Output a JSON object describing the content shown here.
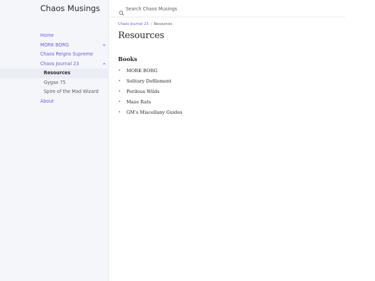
{
  "site": {
    "title": "Chaos Musings"
  },
  "search": {
    "placeholder": "Search Chaos Musings"
  },
  "nav": {
    "items": [
      {
        "label": "Home"
      },
      {
        "label": "MORK BORG"
      },
      {
        "label": "Chaos Reigns Supreme"
      },
      {
        "label": "Chaos Journal 23"
      },
      {
        "label": "About"
      }
    ],
    "sub_items": [
      {
        "label": "Resources"
      },
      {
        "label": "Gygax 75"
      },
      {
        "label": "Spire of the Mad Wizard"
      }
    ]
  },
  "breadcrumb": {
    "parent": "Chaos Journal 23",
    "separator": "/",
    "current": "Resources"
  },
  "page": {
    "title": "Resources",
    "section_heading": "Books",
    "bullet": "•",
    "books": [
      "MORK BORG",
      "Solitary Defilement",
      "Perilous Wilds",
      "Maze Rats",
      "GM's Miscellany Guides"
    ]
  },
  "colors": {
    "accent": "#7253ed",
    "sidebar_bg": "#f5f6fa",
    "active_bg": "#ebedf5",
    "text": "#27262b",
    "muted": "#5c5962"
  },
  "icons": {
    "search": "search-icon",
    "chevron_down": "chevron-down-icon",
    "chevron_up": "chevron-up-icon"
  }
}
